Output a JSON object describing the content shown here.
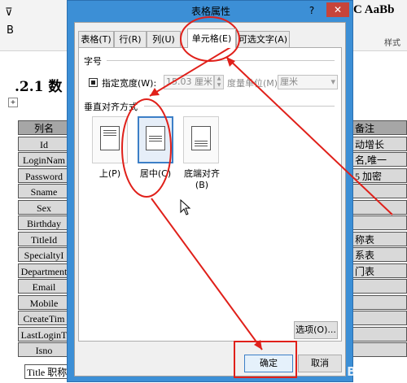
{
  "background_doc": {
    "ribbon_left_chars": [
      "⊽",
      "B"
    ],
    "ribbon_right": {
      "style_preview": "C AaBb",
      "group_label": "样式"
    },
    "heading": ".2.1 数",
    "left_column_cells": [
      "列名",
      "Id",
      "LoginNam",
      "Password",
      "Sname",
      "Sex",
      "Birthday",
      "TitleId",
      "SpecialtyI",
      "Department",
      "Email",
      "Mobile",
      "CreateTim",
      "LastLoginT",
      "Isno"
    ],
    "right_column_cells": [
      "备注",
      "动增长",
      "名,唯一",
      "5 加密",
      "",
      "",
      "",
      "称表",
      "系表",
      "门表",
      "",
      "",
      "",
      "",
      ""
    ],
    "bottom_cell": "Title 职称",
    "para_mark": "↵"
  },
  "dialog": {
    "title": "表格属性",
    "help": "?",
    "close": "✕",
    "tabs": [
      {
        "label": "表格(T)",
        "active": false
      },
      {
        "label": "行(R)",
        "active": false
      },
      {
        "label": "列(U)",
        "active": false
      },
      {
        "label": "单元格(E)",
        "active": true
      },
      {
        "label": "可选文字(A)",
        "active": false
      }
    ],
    "size_section": {
      "title": "字号",
      "specify_width_label": "指定宽度(W):",
      "width_value": "15.03 厘米",
      "unit_label": "度量单位(M):",
      "unit_value": "厘米"
    },
    "vertical_section": {
      "title": "垂直对齐方式",
      "options": [
        {
          "label": "上(P)",
          "selected": false
        },
        {
          "label": "居中(C)",
          "selected": true
        },
        {
          "label": "底端对齐(B)",
          "selected": false
        }
      ]
    },
    "options_button": "选项(O)...",
    "ok_button": "确定",
    "cancel_button": "取消"
  },
  "watermark": "Bai 经验",
  "colors": {
    "accent_blue": "#3c8fd6",
    "annotation_red": "#e0201a",
    "close_red": "#c7443a"
  }
}
